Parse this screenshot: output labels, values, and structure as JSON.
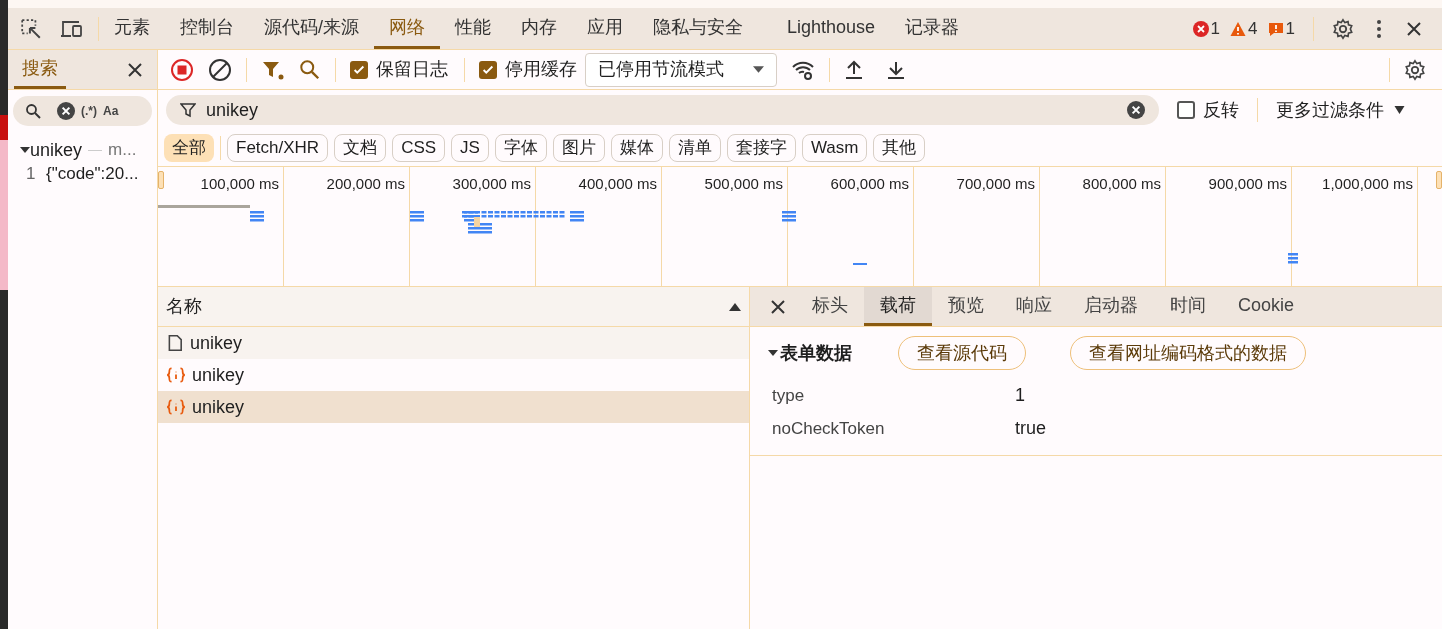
{
  "main_tabs": [
    {
      "label": "元素",
      "selected": false
    },
    {
      "label": "控制台",
      "selected": false
    },
    {
      "label": "源代码/来源",
      "selected": false
    },
    {
      "label": "网络",
      "selected": true
    },
    {
      "label": "性能",
      "selected": false
    },
    {
      "label": "内存",
      "selected": false
    },
    {
      "label": "应用",
      "selected": false
    },
    {
      "label": "隐私与安全",
      "selected": false
    },
    {
      "label": "Lighthouse",
      "selected": false
    },
    {
      "label": "记录器",
      "selected": false
    }
  ],
  "issue_counts": [
    {
      "kind": "error",
      "count": "1"
    },
    {
      "kind": "warning",
      "count": "4"
    },
    {
      "kind": "info",
      "count": "1"
    }
  ],
  "search_panel": {
    "title": "搜索",
    "regex_toggle": "(.*)",
    "case_toggle": "Aa",
    "results": [
      {
        "file": "unikey",
        "path": "m...",
        "expanded": true,
        "lines": [
          {
            "number": "1",
            "text": "{\"code\":20..."
          }
        ]
      }
    ]
  },
  "toolbar": {
    "checkboxes": [
      {
        "label": "保留日志",
        "checked": true
      },
      {
        "label": "停用缓存",
        "checked": true
      }
    ],
    "throttling": "已停用节流模式"
  },
  "filter": {
    "value": "unikey",
    "invert": {
      "label": "反转",
      "checked": false
    },
    "more_filters": "更多过滤条件"
  },
  "type_chips": [
    {
      "label": "全部",
      "selected": true
    },
    {
      "label": "Fetch/XHR",
      "selected": false
    },
    {
      "label": "文档",
      "selected": false
    },
    {
      "label": "CSS",
      "selected": false
    },
    {
      "label": "JS",
      "selected": false
    },
    {
      "label": "字体",
      "selected": false
    },
    {
      "label": "图片",
      "selected": false
    },
    {
      "label": "媒体",
      "selected": false
    },
    {
      "label": "清单",
      "selected": false
    },
    {
      "label": "套接字",
      "selected": false
    },
    {
      "label": "Wasm",
      "selected": false
    },
    {
      "label": "其他",
      "selected": false
    }
  ],
  "timeline_ticks": [
    "100,000 ms",
    "200,000 ms",
    "300,000 ms",
    "400,000 ms",
    "500,000 ms",
    "600,000 ms",
    "700,000 ms",
    "800,000 ms",
    "900,000 ms",
    "1,000,000 ms"
  ],
  "requests": {
    "column": "名称",
    "rows": [
      {
        "name": "unikey",
        "kind": "document",
        "hovered": true,
        "selected": false
      },
      {
        "name": "unikey",
        "kind": "fetch",
        "hovered": false,
        "selected": false
      },
      {
        "name": "unikey",
        "kind": "fetch",
        "hovered": false,
        "selected": true
      }
    ]
  },
  "detail_tabs": [
    {
      "label": "标头",
      "selected": false
    },
    {
      "label": "载荷",
      "selected": true
    },
    {
      "label": "预览",
      "selected": false
    },
    {
      "label": "响应",
      "selected": false
    },
    {
      "label": "启动器",
      "selected": false
    },
    {
      "label": "时间",
      "selected": false
    },
    {
      "label": "Cookie",
      "selected": false
    }
  ],
  "payload": {
    "section": "表单数据",
    "expanded": true,
    "buttons": [
      "查看源代码",
      "查看网址编码格式的数据"
    ],
    "fields": [
      {
        "key": "type",
        "value": "1"
      },
      {
        "key": "noCheckToken",
        "value": "true"
      }
    ]
  }
}
